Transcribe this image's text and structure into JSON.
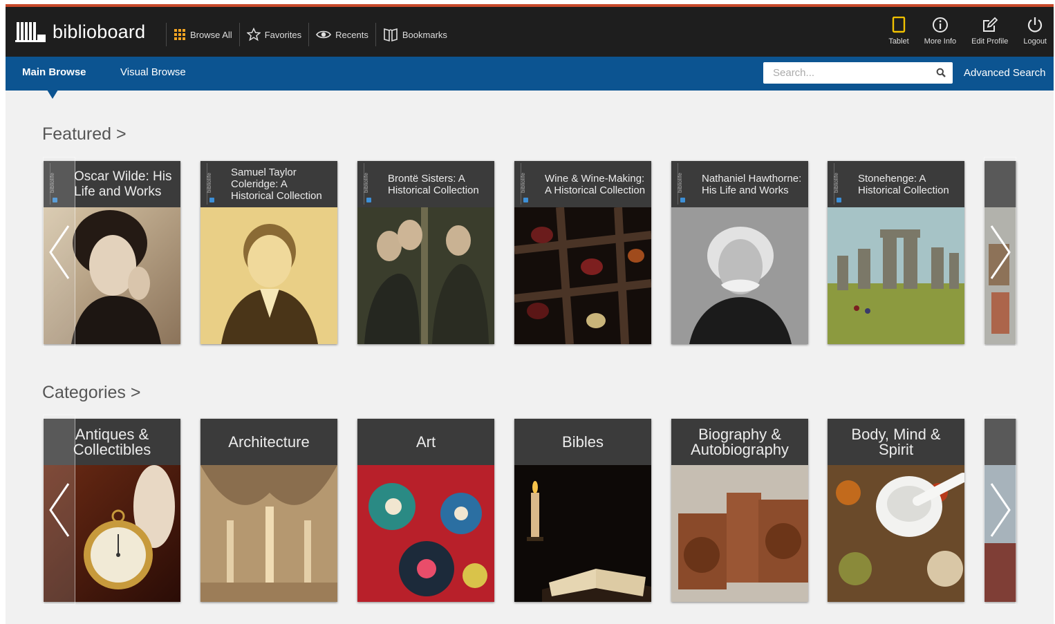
{
  "app": {
    "name": "biblioboard"
  },
  "nav": {
    "browse_all": "Browse All",
    "favorites": "Favorites",
    "recents": "Recents",
    "bookmarks": "Bookmarks"
  },
  "tools": {
    "tablet": "Tablet",
    "more_info": "More Info",
    "edit_profile": "Edit Profile",
    "logout": "Logout"
  },
  "tabs": {
    "main": "Main Browse",
    "visual": "Visual Browse"
  },
  "search": {
    "placeholder": "Search...",
    "advanced": "Advanced Search"
  },
  "featured": {
    "title": "Featured >",
    "spine_label": "bibliolife",
    "items": [
      "Oscar Wilde: His Life and Works",
      "Samuel Taylor Coleridge: A Historical Collection",
      "Brontë Sisters: A Historical Collection",
      "Wine & Wine-Making: A Historical Collection",
      "Nathaniel Hawthorne: His Life and Works",
      "Stonehenge: A Historical Collection"
    ]
  },
  "categories": {
    "title": "Categories >",
    "items": [
      "Antiques & Collectibles",
      "Architecture",
      "Art",
      "Bibles",
      "Biography & Autobiography",
      "Body, Mind & Spirit"
    ]
  },
  "colors": {
    "topbar": "#1e1e1e",
    "bluebar": "#0c5491",
    "accent": "#f5a623",
    "tablet_icon": "#f2c200"
  }
}
